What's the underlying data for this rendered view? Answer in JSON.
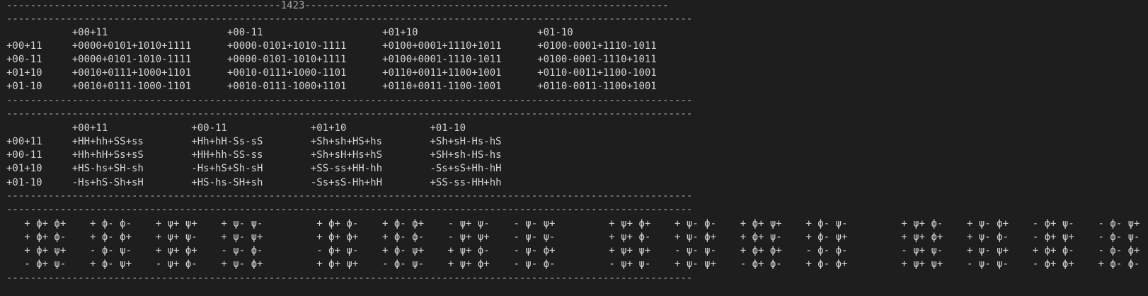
{
  "rule_top": "----------------------------------------------1423-------------------------------------------------------------",
  "rule": "-------------------------------------------------------------------------------------------------------------------",
  "table1": {
    "header": "           +00+11                    +00-11                    +01+10                    +01-10",
    "rows": [
      "+00+11     +0000+0101+1010+1111      +0000-0101+1010-1111      +0100+0001+1110+1011      +0100-0001+1110-1011",
      "+00-11     +0000+0101-1010-1111      +0000-0101-1010+1111      +0100+0001-1110-1011      +0100-0001-1110+1011",
      "+01+10     +0010+0111+1000+1101      +0010-0111+1000-1101      +0110+0011+1100+1001      +0110-0011+1100-1001",
      "+01-10     +0010+0111-1000-1101      +0010-0111-1000+1101      +0110+0011-1100-1001      +0110-0011-1100+1001"
    ]
  },
  "table2": {
    "header": "           +00+11              +00-11              +01+10              +01-10",
    "rows": [
      "+00+11     +HH+hh+SS+ss        +Hh+hH-Ss-sS        +Sh+sh+HS+hs        +Sh+sH-Hs-hS",
      "+00-11     +Hh+hH+Ss+sS        +HH+hh-SS-ss        +Sh+sH+Hs+hS        +SH+sh-HS-hs",
      "+01+10     +HS-hs+SH-sh        -Hs+hS+Sh-sH        +SS-ss+HH-hh        -Ss+sS+Hh-hH",
      "+01-10     -Hs+hS-Sh+sH        +HS-hs-SH+sh        -Ss+sS-Hh+hH        +SS-ss-HH+hh"
    ]
  },
  "table3": {
    "rows": [
      "   + ϕ+ ϕ+    + ϕ- ϕ-    + ψ+ ψ+    + ψ- ψ-         + ϕ+ ϕ-    + ϕ- ϕ+    - ψ+ ψ-    - ψ- ψ+         + ψ+ ϕ+    + ψ- ϕ-    + ϕ+ ψ+    + ϕ- ψ-         + ψ+ ϕ-    + ψ- ϕ+    - ϕ+ ψ-    - ϕ- ψ+",
      "   + ϕ+ ϕ-    + ϕ- ϕ+    + ψ+ ψ-    + ψ- ψ+         + ϕ+ ϕ+    + ϕ- ϕ-    - ψ+ ψ+    - ψ- ψ-         + ψ+ ϕ-    + ψ- ϕ+    + ϕ+ ψ-    + ϕ- ψ+         + ψ+ ϕ+    + ψ- ϕ-    - ϕ+ ψ+    - ϕ- ψ-",
      "   + ϕ+ ψ+    - ϕ- ψ-    + ψ+ ϕ+    - ψ- ϕ-         - ϕ+ ψ-    + ϕ- ψ+    + ψ+ ϕ-    - ψ- ϕ+         + ψ+ ψ+    - ψ- ψ-    + ϕ+ ϕ+    - ϕ- ϕ-         - ψ+ ψ-    + ψ- ψ+    + ϕ+ ϕ-    - ϕ- ϕ+",
      "   - ϕ+ ψ-    + ϕ- ψ+    - ψ+ ϕ-    + ψ- ϕ+         + ϕ+ ψ+    - ϕ- ψ-    + ψ+ ϕ+    - ψ- ϕ-         - ψ+ ψ-    + ψ- ψ+    - ϕ+ ϕ-    + ϕ- ϕ+         + ψ+ ψ+    - ψ- ψ-    - ϕ+ ϕ+    + ϕ- ϕ-"
    ]
  }
}
